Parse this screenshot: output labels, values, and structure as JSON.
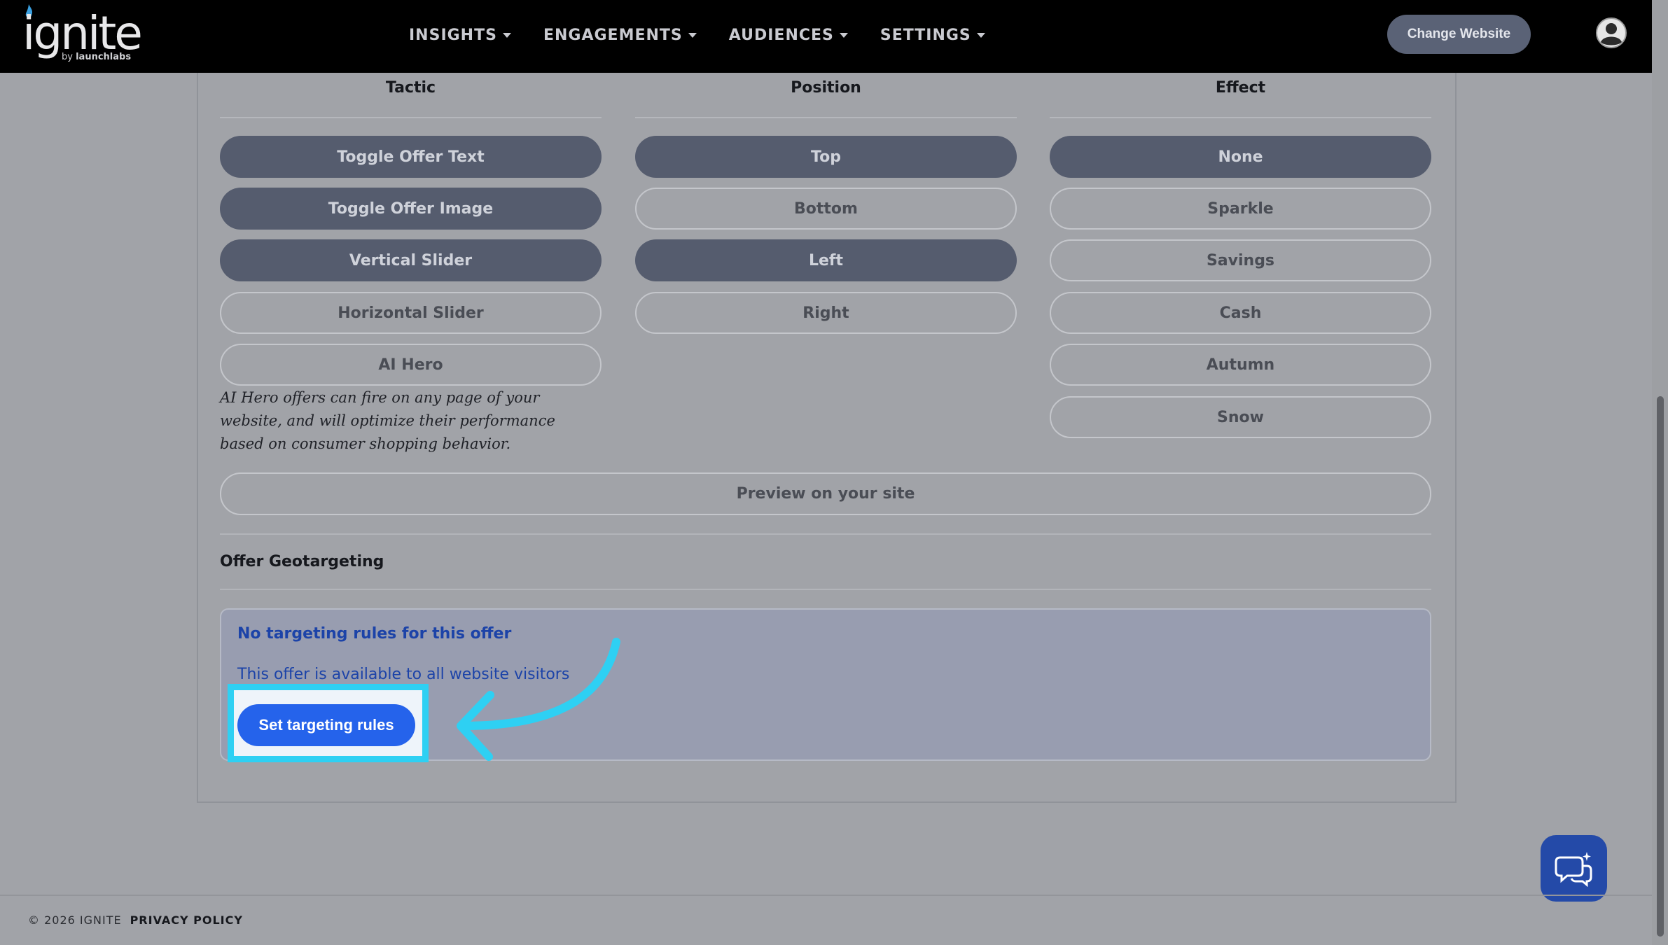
{
  "header": {
    "logo_word": "ignite",
    "logo_by": "by",
    "logo_brand": "launchlabs",
    "nav": [
      {
        "label": "INSIGHTS"
      },
      {
        "label": "ENGAGEMENTS"
      },
      {
        "label": "AUDIENCES"
      },
      {
        "label": "SETTINGS"
      }
    ],
    "change_website": "Change Website"
  },
  "columns": {
    "tactic": {
      "title": "Tactic",
      "options": [
        "Toggle Offer Text",
        "Toggle Offer Image",
        "Vertical Slider",
        "Horizontal Slider",
        "AI Hero"
      ],
      "selected": [
        true,
        true,
        true,
        false,
        false
      ]
    },
    "position": {
      "title": "Position",
      "options": [
        "Top",
        "Bottom",
        "Left",
        "Right"
      ],
      "selected": [
        true,
        false,
        true,
        false
      ]
    },
    "effect": {
      "title": "Effect",
      "options": [
        "None",
        "Sparkle",
        "Savings",
        "Cash",
        "Autumn",
        "Snow"
      ],
      "selected": [
        true,
        false,
        false,
        false,
        false,
        false
      ]
    }
  },
  "ai_hero_note": "AI Hero offers can fire on any page of your website, and will optimize their performance based on consumer shopping behavior.",
  "preview_label": "Preview on your site",
  "geotargeting": {
    "title": "Offer Geotargeting",
    "heading": "No targeting rules for this offer",
    "text": "This offer is available to all website visitors",
    "button": "Set targeting rules"
  },
  "footer": {
    "copyright": "© 2026 IGNITE",
    "privacy": "PRIVACY POLICY"
  },
  "colors": {
    "selected_pill": "#555c6e",
    "primary_button": "#2563eb",
    "highlight": "#2ed0f3",
    "link_text": "#1c43a8"
  },
  "icons": [
    "chevron-down-icon",
    "user-avatar-icon",
    "chat-support-icon",
    "curved-arrow-icon"
  ]
}
